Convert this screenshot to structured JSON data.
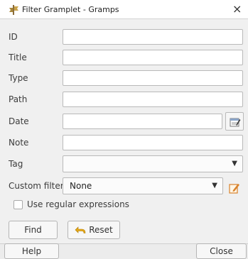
{
  "window": {
    "title": "Filter Gramplet - Gramps",
    "close_glyph": "×",
    "icon": "gramplet-icon"
  },
  "fields": [
    {
      "label": "ID",
      "value": ""
    },
    {
      "label": "Title",
      "value": ""
    },
    {
      "label": "Type",
      "value": ""
    },
    {
      "label": "Path",
      "value": ""
    },
    {
      "label": "Date",
      "value": ""
    },
    {
      "label": "Note",
      "value": ""
    }
  ],
  "tag": {
    "label": "Tag",
    "selected": ""
  },
  "custom_filter": {
    "label": "Custom filter",
    "selected": "None"
  },
  "regex": {
    "label": "Use regular expressions",
    "checked": false
  },
  "buttons": {
    "find": "Find",
    "reset": "Reset",
    "help": "Help",
    "close": "Close"
  },
  "colors": {
    "reset_arrow": "#e6a817",
    "edit_icon": "#d9822b"
  }
}
